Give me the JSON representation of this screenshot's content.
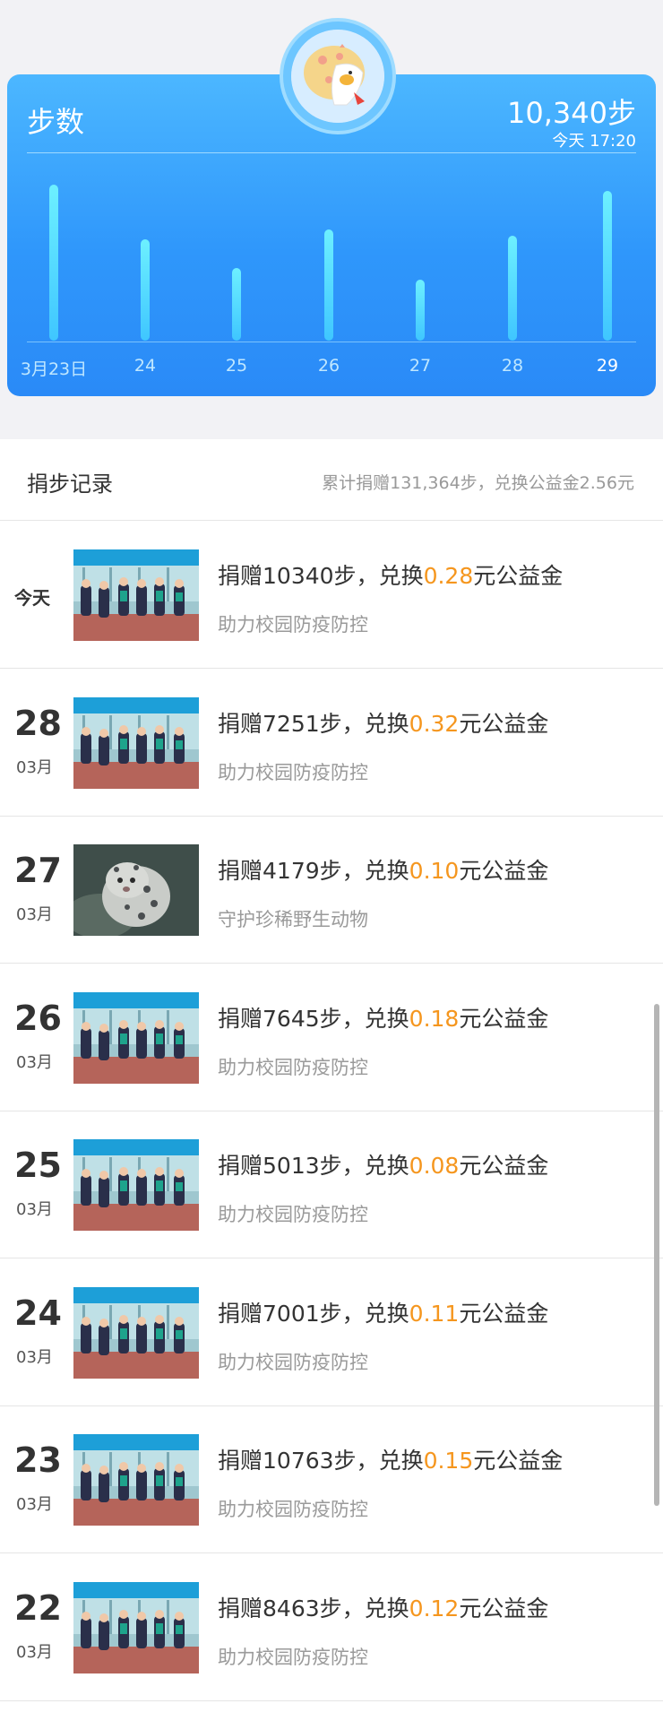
{
  "step_card": {
    "title": "步数",
    "total": "10,340步",
    "time": "今天 17:20",
    "days": [
      {
        "label": "3月23日",
        "steps": 10763,
        "active": false
      },
      {
        "label": "24",
        "steps": 7001,
        "active": false
      },
      {
        "label": "25",
        "steps": 5013,
        "active": false
      },
      {
        "label": "26",
        "steps": 7645,
        "active": false
      },
      {
        "label": "27",
        "steps": 4179,
        "active": false
      },
      {
        "label": "28",
        "steps": 7251,
        "active": false
      },
      {
        "label": "29",
        "steps": 10340,
        "active": true
      }
    ]
  },
  "record": {
    "title": "捐步记录",
    "summary": "累计捐赠131,364步，兑换公益金2.56元",
    "items": [
      {
        "date_text": "今天",
        "day": "",
        "month": "",
        "steps": "10340",
        "amount": "0.28",
        "project": "助力校园防疫防控",
        "thumb_icon": "school-running-photo"
      },
      {
        "date_text": "",
        "day": "28",
        "month": "03月",
        "steps": "7251",
        "amount": "0.32",
        "project": "助力校园防疫防控",
        "thumb_icon": "school-running-photo"
      },
      {
        "date_text": "",
        "day": "27",
        "month": "03月",
        "steps": "4179",
        "amount": "0.10",
        "project": "守护珍稀野生动物",
        "thumb_icon": "snow-leopard-photo"
      },
      {
        "date_text": "",
        "day": "26",
        "month": "03月",
        "steps": "7645",
        "amount": "0.18",
        "project": "助力校园防疫防控",
        "thumb_icon": "school-running-photo"
      },
      {
        "date_text": "",
        "day": "25",
        "month": "03月",
        "steps": "5013",
        "amount": "0.08",
        "project": "助力校园防疫防控",
        "thumb_icon": "school-running-photo"
      },
      {
        "date_text": "",
        "day": "24",
        "month": "03月",
        "steps": "7001",
        "amount": "0.11",
        "project": "助力校园防疫防控",
        "thumb_icon": "school-running-photo"
      },
      {
        "date_text": "",
        "day": "23",
        "month": "03月",
        "steps": "10763",
        "amount": "0.15",
        "project": "助力校园防疫防控",
        "thumb_icon": "school-running-photo"
      },
      {
        "date_text": "",
        "day": "22",
        "month": "03月",
        "steps": "8463",
        "amount": "0.12",
        "project": "助力校园防疫防控",
        "thumb_icon": "school-running-photo"
      }
    ],
    "text_parts": {
      "donate_prefix": "捐赠",
      "donate_suffix": "步，",
      "exchange_prefix": "兑换",
      "exchange_suffix": "元公益金"
    }
  },
  "colors": {
    "card_top": "#4cb7ff",
    "card_bottom": "#2a8af7",
    "bar": "#5fe2ff",
    "money": "#f5961e"
  }
}
